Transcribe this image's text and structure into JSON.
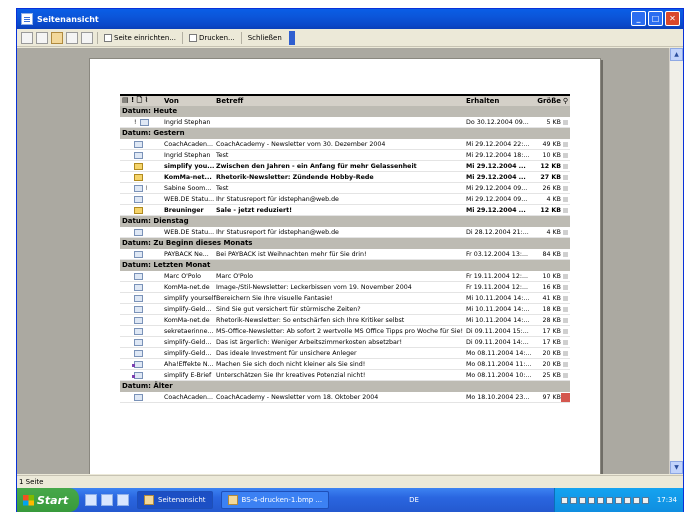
{
  "window": {
    "title": "Seitenansicht"
  },
  "toolbar": {
    "page_setup_label": "Seite einrichten...",
    "print_label": "Drucken...",
    "close_label": "Schließen"
  },
  "columns": {
    "from": "Von",
    "subject": "Betreff",
    "received": "Erhalten",
    "size": "Größe"
  },
  "groups": [
    {
      "label": "Datum: Heute",
      "rows": [
        {
          "icon": "read-envelope",
          "importance": "!",
          "from": "Ingrid Stephan",
          "subject": "",
          "received": "Do 30.12.2004 09...",
          "size": "5 KB",
          "bold": false
        }
      ]
    },
    {
      "label": "Datum: Gestern",
      "rows": [
        {
          "icon": "read-envelope",
          "from": "CoachAcaden...",
          "subject": "CoachAcademy - Newsletter vom 30. Dezember 2004",
          "received": "Mi 29.12.2004 22:...",
          "size": "49 KB",
          "bold": false
        },
        {
          "icon": "read-envelope",
          "from": "Ingrid Stephan",
          "subject": "Test",
          "received": "Mi 29.12.2004 18:...",
          "size": "10 KB",
          "bold": false
        },
        {
          "icon": "unread-envelope",
          "from": "simplify you...",
          "subject": "Zwischen den Jahren - ein Anfang für mehr Gelassenheit",
          "received": "Mi 29.12.2004 ...",
          "size": "12 KB",
          "bold": true
        },
        {
          "icon": "unread-envelope",
          "from": "KomMa-net...",
          "subject": "Rhetorik-Newsletter: Zündende Hobby-Rede",
          "received": "Mi 29.12.2004 ...",
          "size": "27 KB",
          "bold": true
        },
        {
          "icon": "read-envelope",
          "attachment": "⌇",
          "from": "Sabine Soom...",
          "subject": "Test",
          "received": "Mi 29.12.2004 09...",
          "size": "26 KB",
          "bold": false
        },
        {
          "icon": "read-envelope",
          "from": "WEB.DE Statu...",
          "subject": "Ihr Statusreport für idstephan@web.de",
          "received": "Mi 29.12.2004 09...",
          "size": "4 KB",
          "bold": false
        },
        {
          "icon": "unread-envelope",
          "from": "Breuninger",
          "subject": "Sale - jetzt reduziert!",
          "received": "Mi 29.12.2004 ...",
          "size": "12 KB",
          "bold": true
        }
      ]
    },
    {
      "label": "Datum: Dienstag",
      "rows": [
        {
          "icon": "read-envelope",
          "from": "WEB.DE Statu...",
          "subject": "Ihr Statusreport für idstephan@web.de",
          "received": "Di 28.12.2004 21:...",
          "size": "4 KB",
          "bold": false
        }
      ]
    },
    {
      "label": "Datum: Zu Beginn dieses Monats",
      "rows": [
        {
          "icon": "read-envelope",
          "from": "PAYBACK Ne...",
          "subject": "Bei PAYBACK ist Weihnachten mehr für Sie drin!",
          "received": "Fr 03.12.2004 13:...",
          "size": "84 KB",
          "bold": false
        }
      ]
    },
    {
      "label": "Datum: Letzten Monat",
      "rows": [
        {
          "icon": "read-envelope",
          "from": "Marc O'Polo",
          "subject": "Marc O'Polo",
          "received": "Fr 19.11.2004 12:...",
          "size": "10 KB",
          "bold": false
        },
        {
          "icon": "read-envelope",
          "from": "KomMa-net.de",
          "subject": "Image-/Stil-Newsletter: Leckerbissen vom 19. November 2004",
          "received": "Fr 19.11.2004 12:...",
          "size": "16 KB",
          "bold": false
        },
        {
          "icon": "read-envelope",
          "from": "simplify yourself",
          "subject": "Bereichern Sie Ihre visuelle Fantasie!",
          "received": "Mi 10.11.2004 14:...",
          "size": "41 KB",
          "bold": false
        },
        {
          "icon": "read-envelope",
          "from": "simplify-Geld...",
          "subject": "Sind Sie gut versichert für stürmische Zeiten?",
          "received": "Mi 10.11.2004 14:...",
          "size": "18 KB",
          "bold": false
        },
        {
          "icon": "read-envelope",
          "from": "KomMa-net.de",
          "subject": "Rhetorik-Newsletter: So entschärfen sich Ihre Kritiker selbst",
          "received": "Mi 10.11.2004 14:...",
          "size": "28 KB",
          "bold": false
        },
        {
          "icon": "read-envelope",
          "from": "sekretaerinne...",
          "subject": "MS-Office-Newsletter: Ab sofort 2 wertvolle MS Office Tipps pro Woche für Sie!",
          "received": "Di 09.11.2004 15:...",
          "size": "17 KB",
          "bold": false
        },
        {
          "icon": "read-envelope",
          "from": "simplify-Geld...",
          "subject": "Das ist ärgerlich: Weniger Arbeitszimmerkosten absetzbar!",
          "received": "Di 09.11.2004 14:...",
          "size": "17 KB",
          "bold": false
        },
        {
          "icon": "read-envelope",
          "from": "simplify-Geld...",
          "subject": "Das ideale Investment für unsichere Anleger",
          "received": "Mo 08.11.2004 14:...",
          "size": "20 KB",
          "bold": false
        },
        {
          "icon": "replied-envelope",
          "from": "Aha!Effekte N...",
          "subject": "Machen Sie sich doch nicht kleiner als Sie sind!",
          "received": "Mo 08.11.2004 11:...",
          "size": "20 KB",
          "bold": false
        },
        {
          "icon": "replied-envelope",
          "from": "simplify E-Brief",
          "subject": "Unterschätzen Sie Ihr kreatives Potenzial nicht!",
          "received": "Mo 08.11.2004 10:...",
          "size": "25 KB",
          "bold": false
        }
      ]
    },
    {
      "label": "Datum: Älter",
      "rows": [
        {
          "icon": "read-envelope",
          "from": "CoachAcaden...",
          "subject": "CoachAcademy - Newsletter vom 18. Oktober 2004",
          "received": "Mo 18.10.2004 23...",
          "size": "97 KB",
          "bold": false,
          "flag": "red"
        }
      ]
    }
  ],
  "statusbar": {
    "text": "1 Seite"
  },
  "taskbar": {
    "start_label": "Start",
    "tasks": [
      "Seitenansicht",
      "BS-4-drucken-1.bmp ..."
    ],
    "language": "DE",
    "clock": "17:34"
  },
  "colors": {
    "titlebar": "#0b55d9",
    "start": "#389a3b",
    "taskbar": "#2a66e0",
    "flag_red": "#d4574e"
  }
}
